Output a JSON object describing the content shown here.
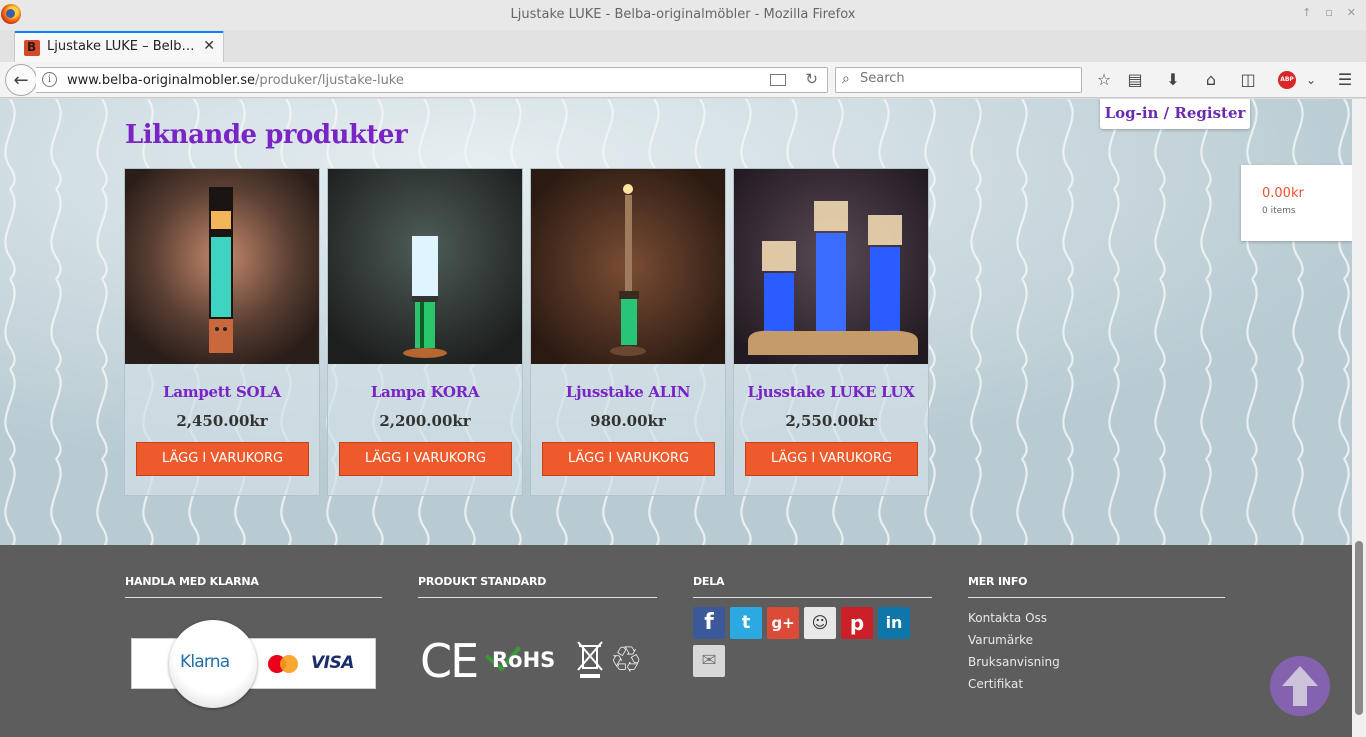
{
  "browser": {
    "window_title": "Ljustake LUKE - Belba-originalmöbler - Mozilla Firefox",
    "tab_title": "Ljustake LUKE – Belb…",
    "url_domain": "www.belba-originalmobler.se",
    "url_path": "/produker/ljustake-luke",
    "search_placeholder": "Search"
  },
  "header": {
    "login_label": "Log-in / Register",
    "cart_total": "0.00kr",
    "cart_items": "0 items"
  },
  "related": {
    "title": "Liknande produkter",
    "products": [
      {
        "name": "Lampett SOLA",
        "price": "2,450.00kr",
        "button": "LÄGG I VARUKORG"
      },
      {
        "name": "Lampa KORA",
        "price": "2,200.00kr",
        "button": "LÄGG I VARUKORG"
      },
      {
        "name": "Ljusstake ALIN",
        "price": "980.00kr",
        "button": "LÄGG I VARUKORG"
      },
      {
        "name": "Ljusstake LUKE LUX",
        "price": "2,550.00kr",
        "button": "LÄGG I VARUKORG"
      }
    ]
  },
  "footer": {
    "klarna": {
      "heading": "HANDLA MED KLARNA",
      "klarna_logo": "Klarna",
      "mastercard_logo": "MasterCard",
      "visa_logo": "VISA"
    },
    "standards": {
      "heading": "PRODUKT STANDARD",
      "ce_mark": "CE",
      "rohs_mark": "RoHS"
    },
    "share": {
      "heading": "DELA",
      "icons": [
        "facebook-icon",
        "twitter-icon",
        "google-plus-icon",
        "reddit-icon",
        "pinterest-icon",
        "linkedin-icon",
        "email-icon"
      ]
    },
    "info": {
      "heading": "MER INFO",
      "links": [
        "Kontakta Oss",
        "Varumärke",
        "Bruksanvisning",
        "Certifikat"
      ]
    }
  },
  "colors": {
    "accent_purple": "#7a24c6",
    "button_orange": "#ee5a2c",
    "footer_bg": "#5d5d5d",
    "price_orange": "#e8532f"
  }
}
